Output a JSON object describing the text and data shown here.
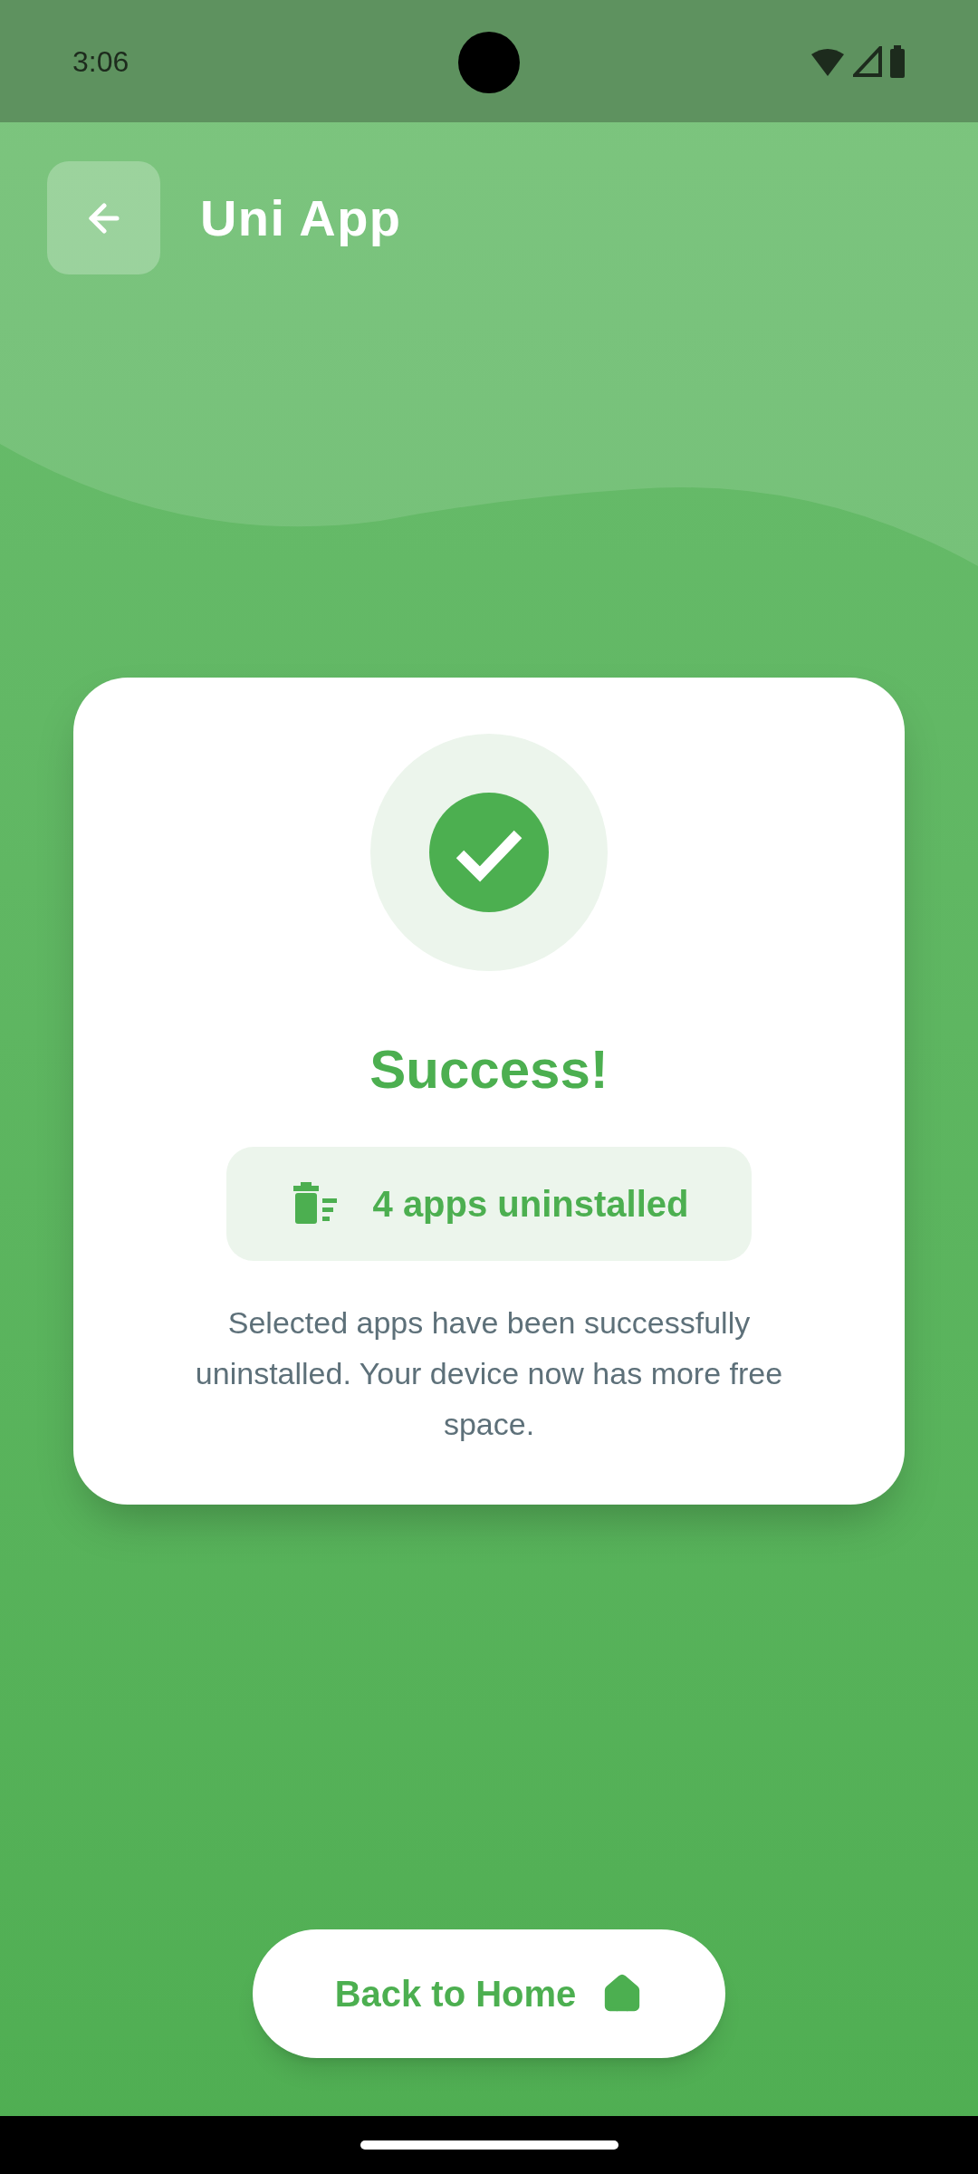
{
  "status_bar": {
    "time": "3:06"
  },
  "header": {
    "title": "Uni App"
  },
  "card": {
    "title": "Success!",
    "badge": "4 apps uninstalled",
    "message": "Selected apps have been successfully uninstalled. Your device now has more free space."
  },
  "home_button": {
    "label": "Back to Home"
  }
}
